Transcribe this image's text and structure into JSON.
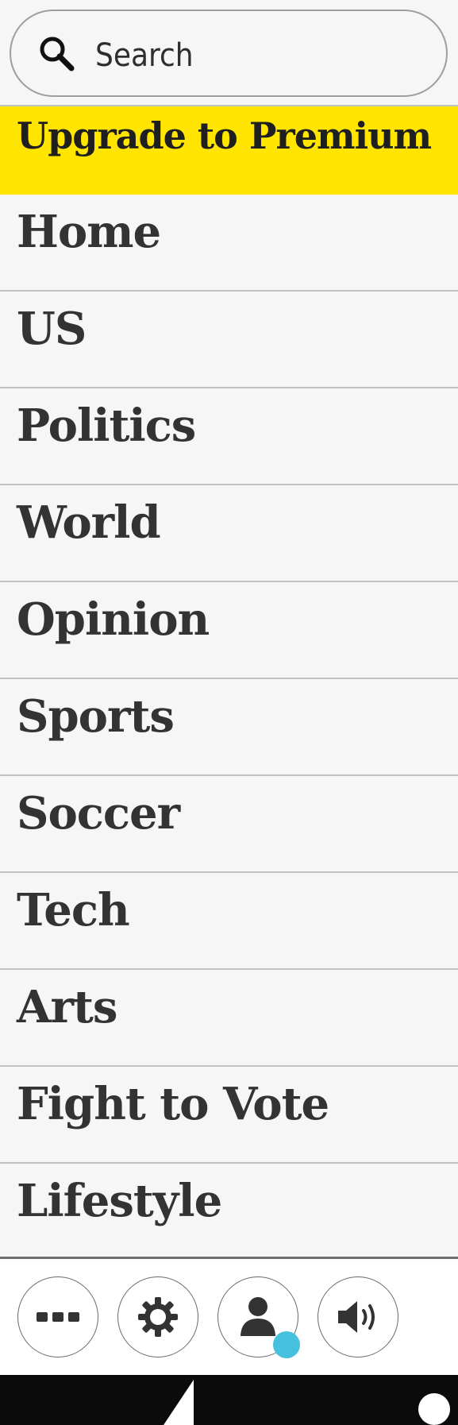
{
  "search": {
    "placeholder": "Search"
  },
  "premium": {
    "label": "Upgrade to Premium",
    "color": "#ffe500"
  },
  "nav": {
    "items": [
      {
        "label": "Home"
      },
      {
        "label": "US"
      },
      {
        "label": "Politics"
      },
      {
        "label": "World"
      },
      {
        "label": "Opinion"
      },
      {
        "label": "Sports"
      },
      {
        "label": "Soccer"
      },
      {
        "label": "Tech"
      },
      {
        "label": "Arts"
      },
      {
        "label": "Fight to Vote"
      },
      {
        "label": "Lifestyle"
      }
    ]
  },
  "bottom_bar": {
    "buttons": [
      {
        "icon": "more-icon"
      },
      {
        "icon": "gear-icon"
      },
      {
        "icon": "profile-icon",
        "badge_color": "#46c1dd"
      },
      {
        "icon": "speaker-icon"
      }
    ]
  },
  "system_nav": {
    "icons": [
      "back-icon",
      "home-icon"
    ]
  }
}
